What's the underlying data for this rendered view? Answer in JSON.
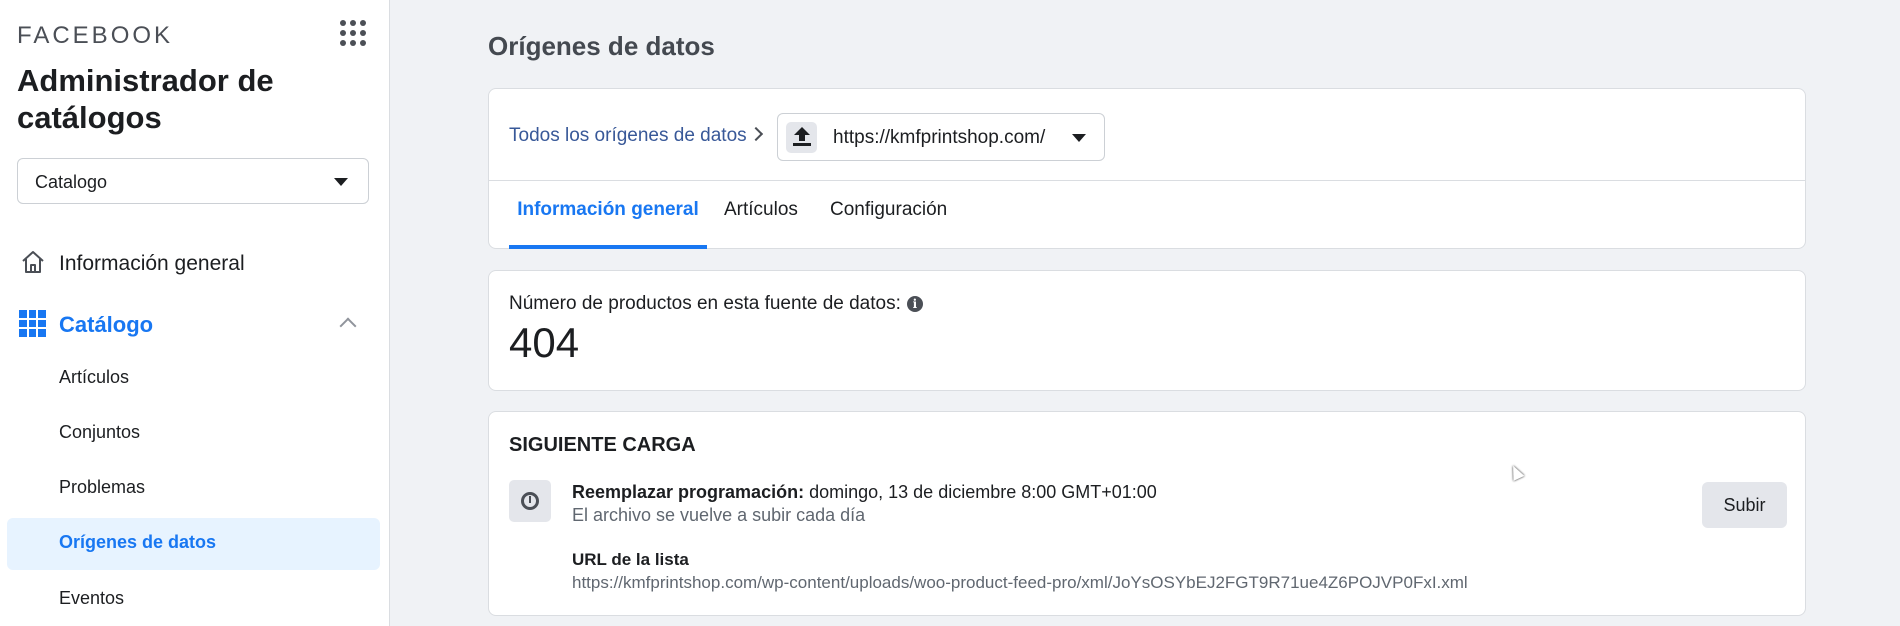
{
  "sidebar": {
    "brand": "FACEBOOK",
    "app_title": "Administrador de catálogos",
    "catalog_select": "Catalogo",
    "nav": {
      "overview": "Información general",
      "catalog": "Catálogo"
    },
    "sub_items": [
      "Artículos",
      "Conjuntos",
      "Problemas",
      "Orígenes de datos",
      "Eventos"
    ],
    "active_sub_item": "Orígenes de datos"
  },
  "main": {
    "page_title": "Orígenes de datos",
    "breadcrumb_link": "Todos los orígenes de datos",
    "source_select": "https://kmfprintshop.com/",
    "tabs": [
      {
        "label": "Información general",
        "active": true
      },
      {
        "label": "Artículos",
        "active": false
      },
      {
        "label": "Configuración",
        "active": false
      }
    ],
    "product_count": {
      "label": "Número de productos en esta fuente de datos:",
      "value": "404"
    },
    "next_upload": {
      "heading": "SIGUIENTE CARGA",
      "schedule_label": "Reemplazar programación:",
      "schedule_value": "domingo, 13 de diciembre 8:00 GMT+01:00",
      "schedule_sub": "El archivo se vuelve a subir cada día",
      "upload_button": "Subir",
      "url_label": "URL de la lista",
      "url_value": "https://kmfprintshop.com/wp-content/uploads/woo-product-feed-pro/xml/JoYsOSYbEJ2FGT9R71ue4Z6POJVP0FxI.xml"
    }
  },
  "colors": {
    "accent": "#1877f2",
    "active_bg": "#e7f3ff",
    "page_bg": "#f0f2f5"
  }
}
